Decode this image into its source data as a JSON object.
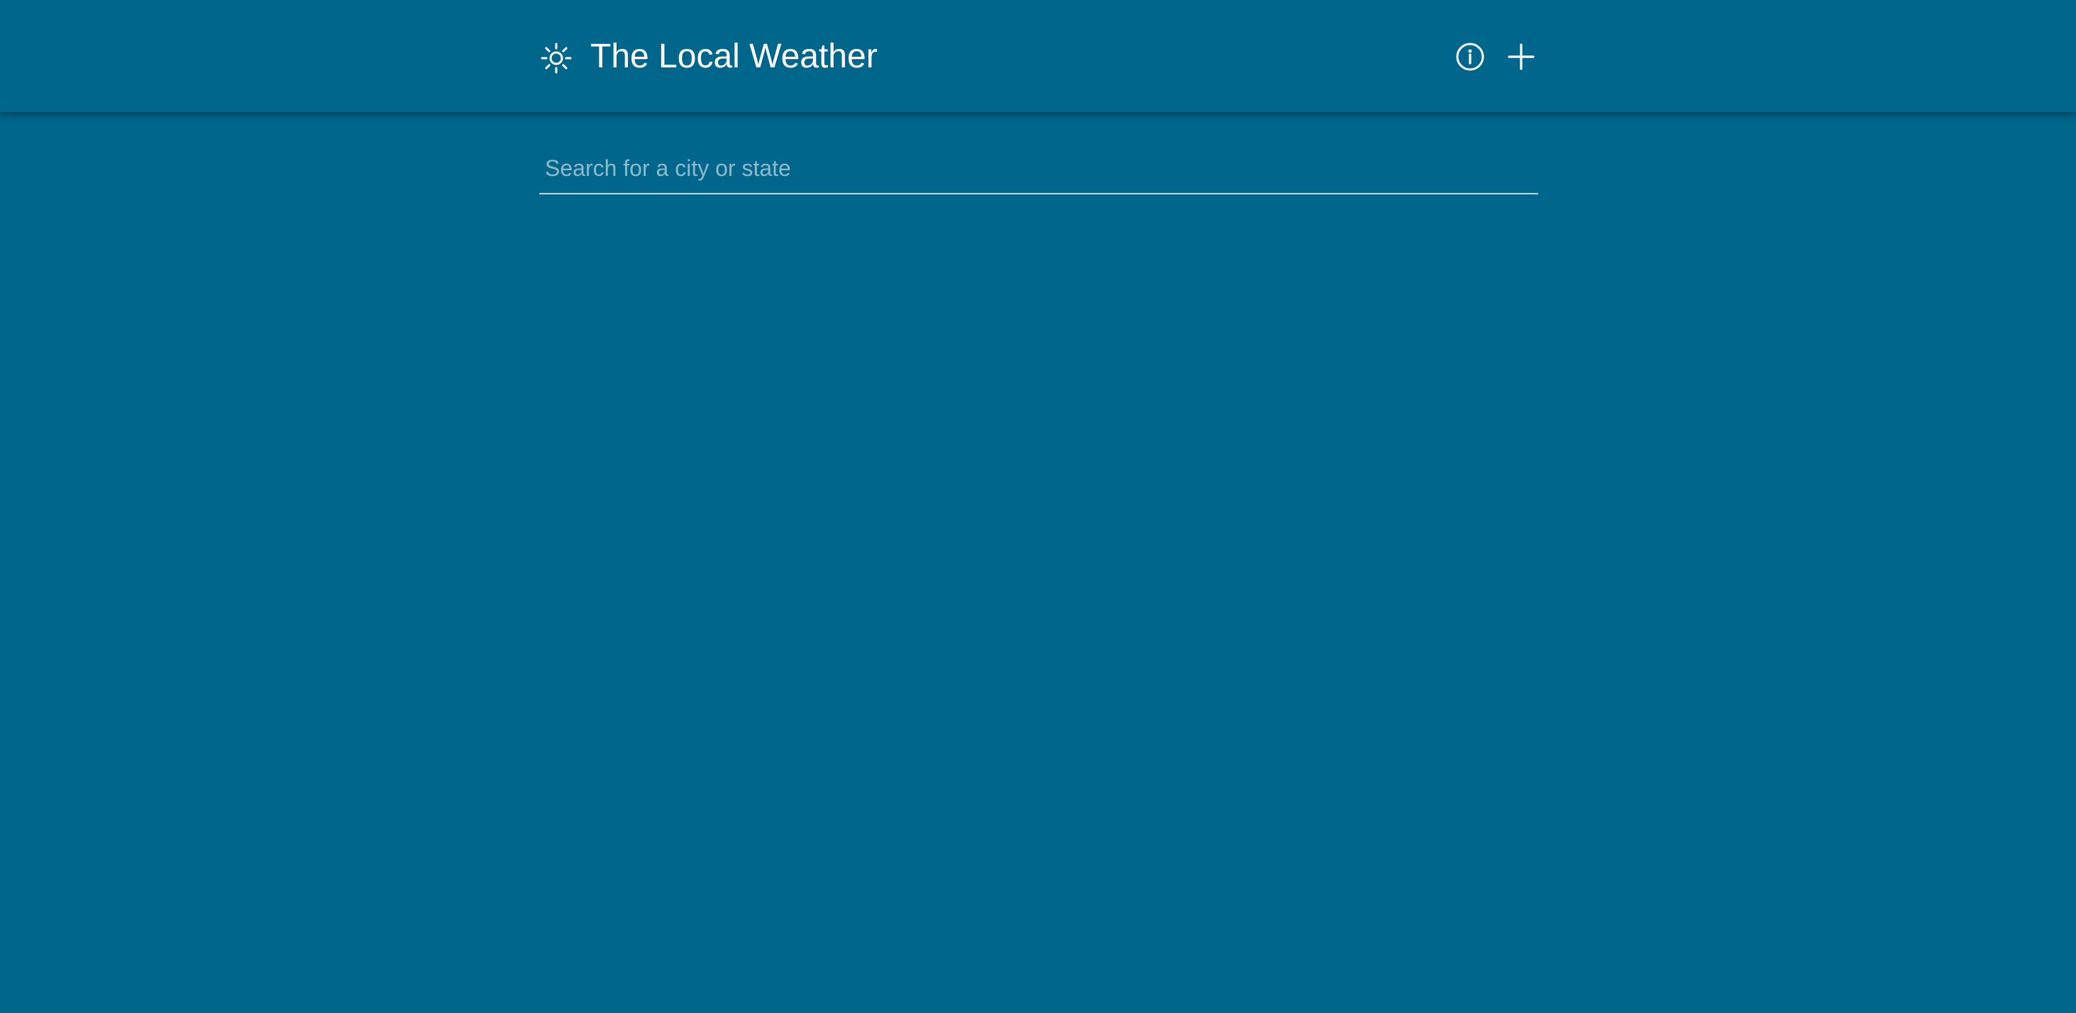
{
  "header": {
    "app_icon": "sun-icon",
    "title": "The Local Weather",
    "actions": [
      {
        "icon": "info-icon"
      },
      {
        "icon": "add-icon"
      }
    ]
  },
  "search": {
    "placeholder": "Search for a city or state",
    "value": ""
  },
  "colors": {
    "background": "#00668b",
    "foreground": "#ffffff"
  }
}
